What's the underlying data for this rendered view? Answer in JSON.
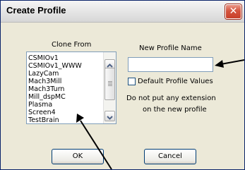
{
  "window": {
    "title": "Create Profile",
    "close_symbol": "✕"
  },
  "clone_from": {
    "label": "Clone From",
    "items": [
      "CSMIOv1",
      "CSMIOv1_WWW",
      "LazyCam",
      "Mach3Mill",
      "Mach3Turn",
      "Mill_dspMC",
      "Plasma",
      "Screen4",
      "TestBrain"
    ]
  },
  "new_profile": {
    "label": "New Profile Name",
    "value": "",
    "default_values_label": "Default Profile Values",
    "default_values_checked": false,
    "hint_line1": "Do not put any extension",
    "hint_line2": "on the new profile"
  },
  "buttons": {
    "ok": "OK",
    "cancel": "Cancel"
  },
  "icons": {
    "close": "close-icon",
    "scroll_up": "arrow-up-icon",
    "scroll_down": "arrow-down-icon"
  },
  "colors": {
    "close_button": "#d4543e",
    "dialog_bg": "#ece9d8",
    "annotation_arrow": "#000000"
  }
}
